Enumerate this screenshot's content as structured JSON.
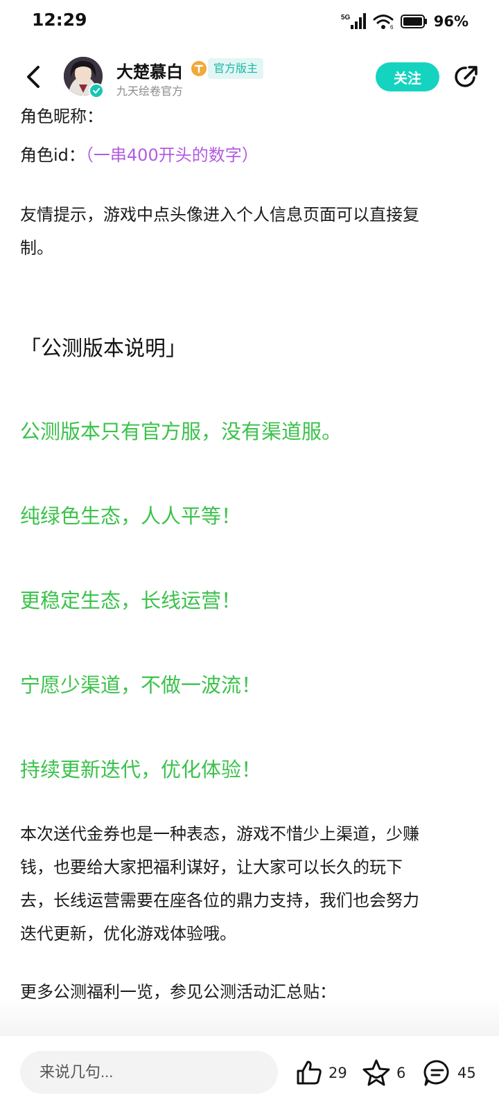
{
  "status_bar": {
    "time": "12:29",
    "network": "5G",
    "battery": "96%"
  },
  "header": {
    "author_name": "大楚慕白",
    "role_badge": "官方版主",
    "author_sub": "九天绘卷官方",
    "follow_label": "关注"
  },
  "article": {
    "role_nickname": "角色昵称：",
    "role_id_label": "角色id：",
    "role_id_hint": "（一串400开头的数字）",
    "tip_line1": "友情提示，游戏中点头像进入个人信息页面可以直接复",
    "tip_line2": "制。",
    "section_title": "「公测版本说明」",
    "green_lines": [
      "公测版本只有官方服，没有渠道服。",
      "纯绿色生态，人人平等！",
      "更稳定生态，长线运营！",
      "宁愿少渠道，不做一波流！",
      "持续更新迭代，优化体验！"
    ],
    "para_lines": [
      "本次送代金券也是一种表态，游戏不惜少上渠道，少赚",
      "钱，也要给大家把福利谋好，让大家可以长久的玩下",
      "去，长线运营需要在座各位的鼎力支持，我们也会努力",
      "迭代更新，优化游戏体验哦。"
    ],
    "more_line": "更多公测福利一览，参见公测活动汇总贴："
  },
  "bottom_bar": {
    "comment_placeholder": "来说几句...",
    "like_count": "29",
    "favorite_count": "6",
    "comment_count": "45"
  },
  "colors": {
    "accent": "#14d4c0",
    "green_text": "#3bc24b",
    "purple_text": "#b25be0"
  }
}
